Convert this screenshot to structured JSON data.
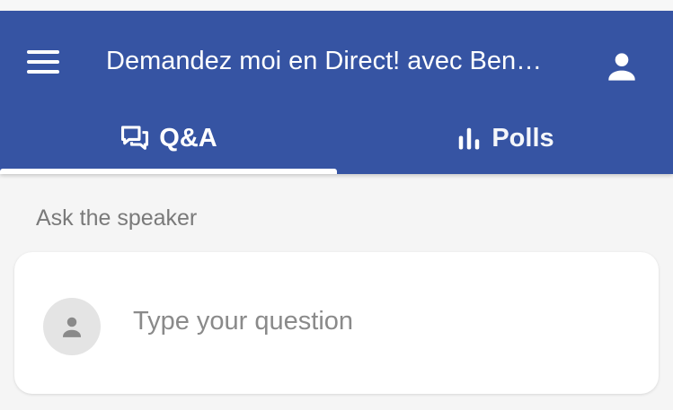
{
  "header": {
    "title": "Demandez moi en Direct! avec Ben…",
    "menu_icon": "hamburger-menu-icon",
    "account_icon": "person-icon"
  },
  "tabs": [
    {
      "label": "Q&A",
      "icon": "chat-bubbles-icon",
      "active": true
    },
    {
      "label": "Polls",
      "icon": "bar-chart-icon",
      "active": false
    }
  ],
  "qa": {
    "section_label": "Ask the speaker",
    "input_placeholder": "Type your question",
    "avatar_icon": "person-icon"
  },
  "colors": {
    "app_bar": "#3654a3",
    "background": "#f5f5f5",
    "card": "#ffffff"
  }
}
